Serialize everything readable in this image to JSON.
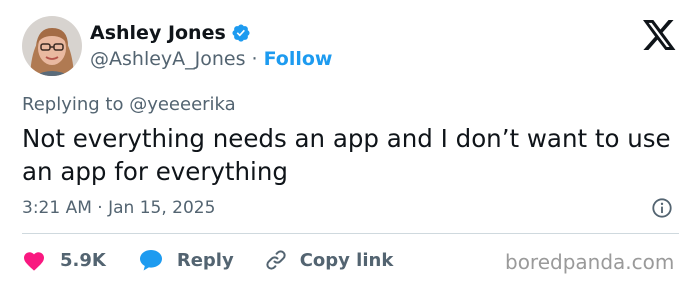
{
  "author": {
    "name": "Ashley Jones",
    "handle": "@AshleyA_Jones",
    "separator": "·",
    "follow_label": "Follow",
    "verified_icon": "verified-badge-icon",
    "verified_color": "#1d9bf0"
  },
  "platform_icon": "x-logo-icon",
  "reply_context": "Replying to @yeeeerika",
  "tweet_text": "Not everything needs an app and I don’t want to use an app for everything",
  "timestamp": "3:21 AM · Jan 15, 2025",
  "actions": {
    "likes": {
      "icon": "heart-icon",
      "count": "5.9K",
      "color": "#f91880"
    },
    "reply": {
      "icon": "speech-bubble-icon",
      "label": "Reply",
      "color": "#1d9bf0"
    },
    "copy": {
      "icon": "link-icon",
      "label": "Copy link"
    }
  },
  "info_icon": "info-icon",
  "watermark": "boredpanda.com"
}
